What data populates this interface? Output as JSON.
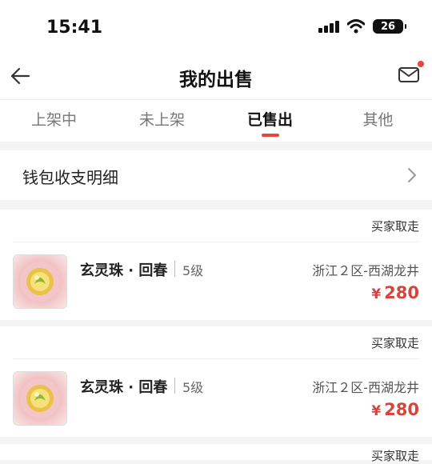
{
  "status_bar": {
    "time": "15:41",
    "battery": "26"
  },
  "nav": {
    "title": "我的出售",
    "back_icon": "arrow-left-icon",
    "mail_icon": "mail-icon"
  },
  "tabs": [
    {
      "label": "上架中",
      "active": false
    },
    {
      "label": "未上架",
      "active": false
    },
    {
      "label": "已售出",
      "active": true
    },
    {
      "label": "其他",
      "active": false
    }
  ],
  "wallet": {
    "label": "钱包收支明细"
  },
  "orders": [
    {
      "status": "买家取走",
      "name": "玄灵珠 · 回春",
      "level": "5级",
      "server": "浙江２区-西湖龙井",
      "currency": "¥",
      "price": "280"
    },
    {
      "status": "买家取走",
      "name": "玄灵珠 · 回春",
      "level": "5级",
      "server": "浙江２区-西湖龙井",
      "currency": "¥",
      "price": "280"
    }
  ],
  "partial_next_status": "买家取走",
  "colors": {
    "accent": "#e8453c",
    "price": "#d6443c",
    "background": "#f4f4f4"
  }
}
